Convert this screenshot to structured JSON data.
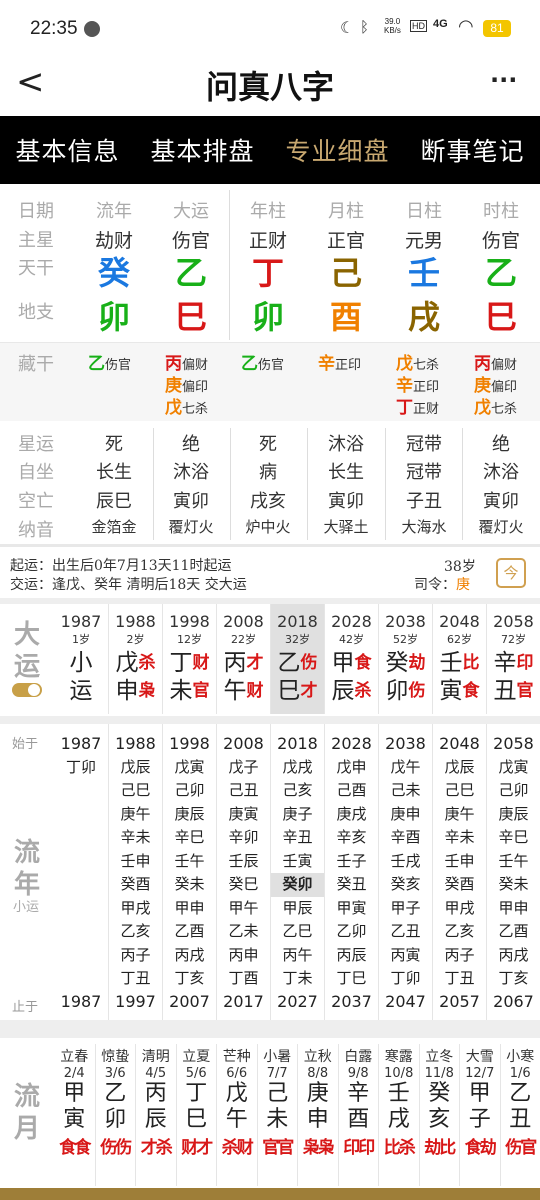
{
  "status": {
    "time": "22:35",
    "net_speed": "39.0",
    "net_unit": "KB/s",
    "hd": "HD",
    "signal": "4G",
    "battery": "81"
  },
  "header": {
    "title": "问真八字",
    "back": "<",
    "more": "···"
  },
  "tabs": [
    "基本信息",
    "基本排盘",
    "专业细盘",
    "断事笔记"
  ],
  "pillar_labels": {
    "row_labels": [
      "日期",
      "主星",
      "天干",
      "地支"
    ],
    "cols": [
      "流年",
      "大运",
      "年柱",
      "月柱",
      "日柱",
      "时柱"
    ]
  },
  "zhuxing": [
    "劫财",
    "伤官",
    "正财",
    "正官",
    "元男",
    "伤官"
  ],
  "tiangan": [
    "癸",
    "乙",
    "丁",
    "己",
    "壬",
    "乙"
  ],
  "dizhi": [
    "卯",
    "巳",
    "卯",
    "酉",
    "戌",
    "巳"
  ],
  "canggan_label": "藏干",
  "canggan": [
    [
      {
        "g": "乙",
        "s": "伤官"
      }
    ],
    [
      {
        "g": "丙",
        "s": "偏财"
      },
      {
        "g": "庚",
        "s": "偏印"
      },
      {
        "g": "戊",
        "s": "七杀"
      }
    ],
    [
      {
        "g": "乙",
        "s": "伤官"
      }
    ],
    [
      {
        "g": "辛",
        "s": "正印"
      }
    ],
    [
      {
        "g": "戊",
        "s": "七杀"
      },
      {
        "g": "辛",
        "s": "正印"
      },
      {
        "g": "丁",
        "s": "正财"
      }
    ],
    [
      {
        "g": "丙",
        "s": "偏财"
      },
      {
        "g": "庚",
        "s": "偏印"
      },
      {
        "g": "戊",
        "s": "七杀"
      }
    ]
  ],
  "extra_labels": [
    "星运",
    "自坐",
    "空亡",
    "纳音"
  ],
  "xingyun": [
    "死",
    "绝",
    "死",
    "沐浴",
    "冠带",
    "绝"
  ],
  "zizuo": [
    "长生",
    "沐浴",
    "病",
    "长生",
    "冠带",
    "沐浴"
  ],
  "kongwang": [
    "辰巳",
    "寅卯",
    "戌亥",
    "寅卯",
    "子丑",
    "寅卯"
  ],
  "nayin": [
    "金箔金",
    "覆灯火",
    "炉中火",
    "大驿土",
    "大海水",
    "覆灯火"
  ],
  "qiyun": {
    "line1_label": "起运：",
    "line1": "出生后0年7月13天11时起运",
    "line2_label": "交运：",
    "line2": "逢戊、癸年 清明后18天 交大运",
    "age": "38岁",
    "siling_label": "司令：",
    "siling": "庚",
    "cal_icon": "今"
  },
  "dayun": {
    "label1": "大",
    "label2": "运",
    "cols": [
      {
        "yr": "1987",
        "age": "1岁",
        "g1": "小",
        "g2": "运",
        "s1": "",
        "s2": ""
      },
      {
        "yr": "1988",
        "age": "2岁",
        "g1": "戊",
        "g2": "申",
        "s1": "杀",
        "s2": "枭"
      },
      {
        "yr": "1998",
        "age": "12岁",
        "g1": "丁",
        "g2": "未",
        "s1": "财",
        "s2": "官"
      },
      {
        "yr": "2008",
        "age": "22岁",
        "g1": "丙",
        "g2": "午",
        "s1": "才",
        "s2": "财"
      },
      {
        "yr": "2018",
        "age": "32岁",
        "g1": "乙",
        "g2": "巳",
        "s1": "伤",
        "s2": "才"
      },
      {
        "yr": "2028",
        "age": "42岁",
        "g1": "甲",
        "g2": "辰",
        "s1": "食",
        "s2": "杀"
      },
      {
        "yr": "2038",
        "age": "52岁",
        "g1": "癸",
        "g2": "卯",
        "s1": "劫",
        "s2": "伤"
      },
      {
        "yr": "2048",
        "age": "62岁",
        "g1": "壬",
        "g2": "寅",
        "s1": "比",
        "s2": "食"
      },
      {
        "yr": "2058",
        "age": "72岁",
        "g1": "辛",
        "g2": "丑",
        "s1": "印",
        "s2": "官"
      }
    ]
  },
  "liunian": {
    "start_label": "始于",
    "end_label": "止于",
    "label1": "流",
    "label2": "年",
    "sub": "小运",
    "cols": [
      {
        "start": "1987",
        "years": [
          "丁卯"
        ],
        "end": "1987"
      },
      {
        "start": "1988",
        "years": [
          "戊辰",
          "己巳",
          "庚午",
          "辛未",
          "壬申",
          "癸酉",
          "甲戌",
          "乙亥",
          "丙子",
          "丁丑"
        ],
        "end": "1997"
      },
      {
        "start": "1998",
        "years": [
          "戊寅",
          "己卯",
          "庚辰",
          "辛巳",
          "壬午",
          "癸未",
          "甲申",
          "乙酉",
          "丙戌",
          "丁亥"
        ],
        "end": "2007"
      },
      {
        "start": "2008",
        "years": [
          "戊子",
          "己丑",
          "庚寅",
          "辛卯",
          "壬辰",
          "癸巳",
          "甲午",
          "乙未",
          "丙申",
          "丁酉"
        ],
        "end": "2017"
      },
      {
        "start": "2018",
        "years": [
          "戊戌",
          "己亥",
          "庚子",
          "辛丑",
          "壬寅",
          "癸卯",
          "甲辰",
          "乙巳",
          "丙午",
          "丁未"
        ],
        "end": "2027"
      },
      {
        "start": "2028",
        "years": [
          "戊申",
          "己酉",
          "庚戌",
          "辛亥",
          "壬子",
          "癸丑",
          "甲寅",
          "乙卯",
          "丙辰",
          "丁巳"
        ],
        "end": "2037"
      },
      {
        "start": "2038",
        "years": [
          "戊午",
          "己未",
          "庚申",
          "辛酉",
          "壬戌",
          "癸亥",
          "甲子",
          "乙丑",
          "丙寅",
          "丁卯"
        ],
        "end": "2047"
      },
      {
        "start": "2048",
        "years": [
          "戊辰",
          "己巳",
          "庚午",
          "辛未",
          "壬申",
          "癸酉",
          "甲戌",
          "乙亥",
          "丙子",
          "丁丑"
        ],
        "end": "2057"
      },
      {
        "start": "2058",
        "years": [
          "戊寅",
          "己卯",
          "庚辰",
          "辛巳",
          "壬午",
          "癸未",
          "甲申",
          "乙酉",
          "丙戌",
          "丁亥"
        ],
        "end": "2067"
      }
    ]
  },
  "liuyue": {
    "label1": "流",
    "label2": "月",
    "cols": [
      {
        "jq": "立春",
        "d": "2/4",
        "g": "甲",
        "z": "寅",
        "s": "食食"
      },
      {
        "jq": "惊蛰",
        "d": "3/6",
        "g": "乙",
        "z": "卯",
        "s": "伤伤"
      },
      {
        "jq": "清明",
        "d": "4/5",
        "g": "丙",
        "z": "辰",
        "s": "才杀"
      },
      {
        "jq": "立夏",
        "d": "5/6",
        "g": "丁",
        "z": "巳",
        "s": "财才"
      },
      {
        "jq": "芒种",
        "d": "6/6",
        "g": "戊",
        "z": "午",
        "s": "杀财"
      },
      {
        "jq": "小暑",
        "d": "7/7",
        "g": "己",
        "z": "未",
        "s": "官官"
      },
      {
        "jq": "立秋",
        "d": "8/8",
        "g": "庚",
        "z": "申",
        "s": "枭枭"
      },
      {
        "jq": "白露",
        "d": "9/8",
        "g": "辛",
        "z": "酉",
        "s": "印印"
      },
      {
        "jq": "寒露",
        "d": "10/8",
        "g": "壬",
        "z": "戌",
        "s": "比杀"
      },
      {
        "jq": "立冬",
        "d": "11/8",
        "g": "癸",
        "z": "亥",
        "s": "劫比"
      },
      {
        "jq": "大雪",
        "d": "12/7",
        "g": "甲",
        "z": "子",
        "s": "食劫"
      },
      {
        "jq": "小寒",
        "d": "1/6",
        "g": "乙",
        "z": "丑",
        "s": "伤官"
      }
    ]
  },
  "colors": {
    "accent_gold": "#c8a870",
    "red": "#d81818",
    "green": "#18b018",
    "blue": "#1a78e0",
    "brown": "#8a6400",
    "orange": "#f08000"
  }
}
